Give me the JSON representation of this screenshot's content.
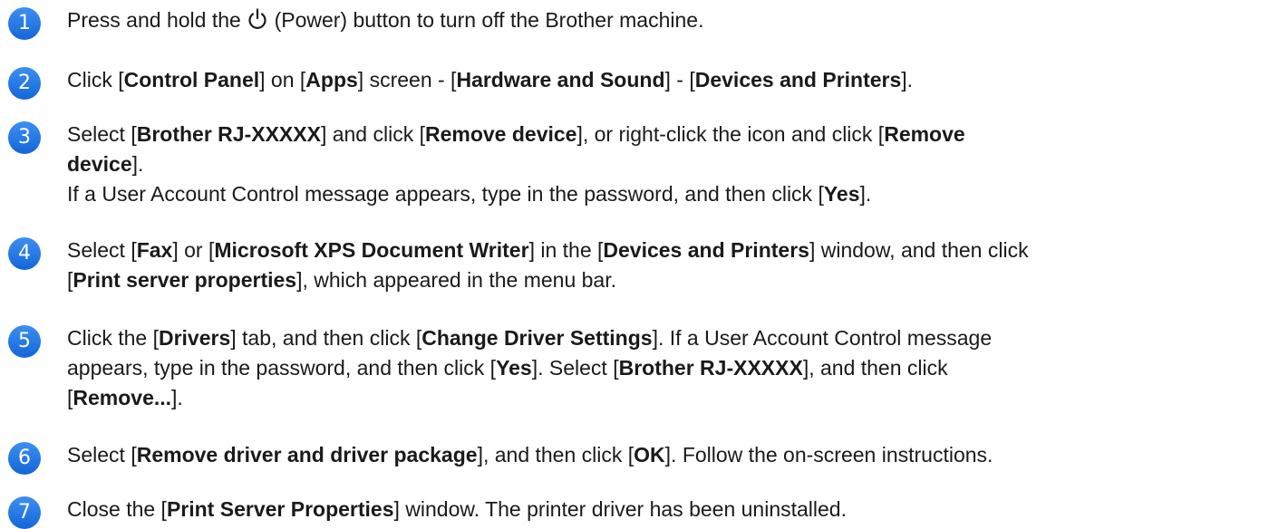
{
  "steps": [
    {
      "number": "1",
      "text": {
        "a": "Press and hold the ",
        "b": " (Power) button to turn off the Brother machine."
      }
    },
    {
      "number": "2",
      "text": {
        "a": "Click [",
        "b": "Control Panel",
        "c": "] on [",
        "d": "Apps",
        "e": "] screen - [",
        "f": "Hardware and Sound",
        "g": "] - [",
        "h": "Devices and Printers",
        "i": "]."
      }
    },
    {
      "number": "3",
      "text": {
        "a": "Select [",
        "b": "Brother RJ-XXXXX",
        "c": "] and click [",
        "d": "Remove device",
        "e": "], or right-click the icon and click [",
        "f": "Remove",
        "g": "device",
        "h": "].",
        "i": "If a User Account Control message appears, type in the password, and then click [",
        "j": "Yes",
        "k": "]."
      }
    },
    {
      "number": "4",
      "text": {
        "a": "Select [",
        "b": "Fax",
        "c": "] or [",
        "d": "Microsoft XPS Document Writer",
        "e": "] in the [",
        "f": "Devices and Printers",
        "g": "] window, and then click",
        "h": "[",
        "i": "Print server properties",
        "j": "], which appeared in the menu bar."
      }
    },
    {
      "number": "5",
      "text": {
        "a": "Click the [",
        "b": "Drivers",
        "c": "] tab, and then click [",
        "d": "Change Driver Settings",
        "e": "]. If a User Account Control message",
        "f": "appears, type in the password, and then click [",
        "g": "Yes",
        "h": "]. Select [",
        "i": "Brother RJ-XXXXX",
        "j": "], and then click",
        "k": "[",
        "l": "Remove...",
        "m": "]."
      }
    },
    {
      "number": "6",
      "text": {
        "a": "Select [",
        "b": "Remove driver and driver package",
        "c": "], and then click [",
        "d": "OK",
        "e": "]. Follow the on-screen instructions."
      }
    },
    {
      "number": "7",
      "text": {
        "a": "Close the [",
        "b": "Print Server Properties",
        "c": "] window. The printer driver has been uninstalled."
      }
    }
  ],
  "icons": {
    "badge_color": "#1f77e0",
    "power": "power-icon"
  }
}
